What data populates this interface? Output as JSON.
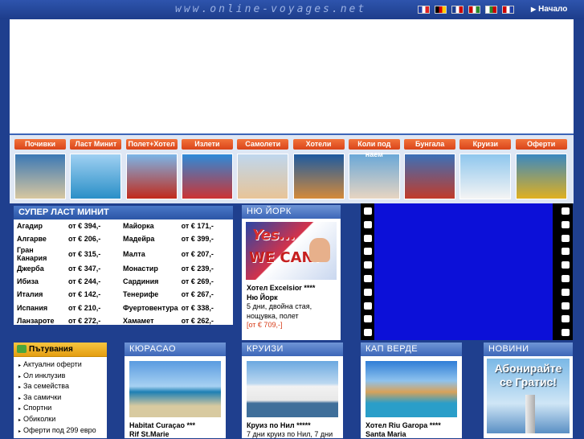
{
  "header": {
    "site_url": "www.online-voyages.net",
    "home_label": "Начало",
    "flags": [
      {
        "name": "france-flag",
        "colors": [
          "#1f3fa8",
          "#ffffff",
          "#d22"
        ]
      },
      {
        "name": "germany-flag",
        "colors": [
          "#000000",
          "#d00",
          "#fc0"
        ]
      },
      {
        "name": "uk-flag",
        "colors": [
          "#1d3f92",
          "#ffffff",
          "#c00"
        ]
      },
      {
        "name": "hungary-flag",
        "colors": [
          "#c00",
          "#ffffff",
          "#2a8a2a"
        ]
      },
      {
        "name": "bulgaria-flag",
        "colors": [
          "#ffffff",
          "#2a8a2a",
          "#c00"
        ]
      },
      {
        "name": "netherlands-flag",
        "colors": [
          "#c00",
          "#ffffff",
          "#1f3fa8"
        ]
      }
    ]
  },
  "categories": [
    {
      "label": "Почивки",
      "colors": [
        "#3b78b5",
        "#d8c7a0"
      ]
    },
    {
      "label": "Ласт Минит",
      "colors": [
        "#9fd0f2",
        "#2a8fc7"
      ]
    },
    {
      "label": "Полет+Хотел",
      "colors": [
        "#7bb5e8",
        "#c22a1b"
      ]
    },
    {
      "label": "Излети",
      "colors": [
        "#2e8ad8",
        "#c33"
      ]
    },
    {
      "label": "Самолети",
      "colors": [
        "#bfd7ee",
        "#e8c497"
      ]
    },
    {
      "label": "Хотели",
      "colors": [
        "#1d5aa0",
        "#d48a3a"
      ]
    },
    {
      "label": "Коли под наем",
      "colors": [
        "#6aa8d8",
        "#e8d5c2"
      ]
    },
    {
      "label": "Бунгала",
      "colors": [
        "#3b70b8",
        "#c23b2a"
      ]
    },
    {
      "label": "Круизи",
      "colors": [
        "#8fc7ee",
        "#f4f4f4"
      ]
    },
    {
      "label": "Оферти",
      "colors": [
        "#3b88c0",
        "#e0b020"
      ]
    }
  ],
  "last_minute": {
    "title": "СУПЕР ЛАСТ МИНИТ",
    "rows": [
      [
        "Агадир",
        "от € 394,-",
        "Майорка",
        "от € 171,-"
      ],
      [
        "Алгарве",
        "от € 206,-",
        "Мадейра",
        "от € 399,-"
      ],
      [
        "Гран Канария",
        "от € 315,-",
        "Малта",
        "от € 207,-"
      ],
      [
        "Джерба",
        "от € 347,-",
        "Монастир",
        "от € 239,-"
      ],
      [
        "Ибиза",
        "от € 244,-",
        "Сардиния",
        "от € 269,-"
      ],
      [
        "Италия",
        "от € 142,-",
        "Тенерифе",
        "от € 267,-"
      ],
      [
        "Испания",
        "от € 210,-",
        "Фуертовентура",
        "от € 338,-"
      ],
      [
        "Ланзароте",
        "от € 272,-",
        "Хамамет",
        "от € 262,-"
      ]
    ]
  },
  "new_york": {
    "title": "НЮ ЙОРК",
    "image_text_1": "Yes...",
    "image_text_2": "WE CAN!",
    "hotel": "Хотел Excelsior ****",
    "city": "Ню Йорк",
    "desc_1": "5 дни, двойна стая,",
    "desc_2": "нощувка, полет",
    "price": "[от € 709,-]"
  },
  "travel": {
    "title": "Пътувания",
    "items": [
      "Актуални оферти",
      "Ол инклузив",
      "За семейства",
      "За самички",
      "Спортни",
      "Обиколки",
      "Оферти под 299 евро"
    ]
  },
  "curacao": {
    "title": "КЮРАСАО",
    "line1": "Habitat Curaçao ***",
    "line2": "Rif St.Marie"
  },
  "cruises": {
    "title": "КРУИЗИ",
    "line1": "Круиз по Нил *****",
    "line2": "7 дни круиз по Нил, 7 дни"
  },
  "cape_verde": {
    "title": "КАП ВЕРДЕ",
    "line1": "Хотел Riu Garopa ****",
    "line2": "Santa Maria"
  },
  "news": {
    "title": "НОВИНИ",
    "line1": "Абонирайте",
    "line2": "се Гратис!"
  }
}
